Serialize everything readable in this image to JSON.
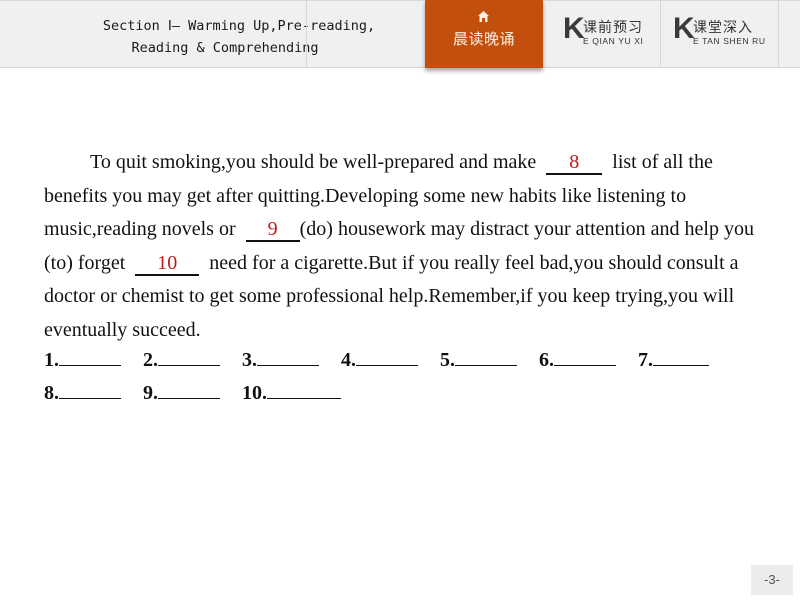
{
  "header": {
    "section_title_line1": "Section Ⅰ— Warming Up,Pre-reading,",
    "section_title_line2": "Reading & Comprehending",
    "tabs": [
      {
        "label": "晨读晚诵",
        "icon": "home-icon",
        "active": true,
        "color": "#c2500c"
      },
      {
        "k": "K",
        "label": "课前预习",
        "pinyin": "E QIAN YU XI",
        "active": false
      },
      {
        "k": "K",
        "label": "课堂深入",
        "pinyin": "E TAN SHEN RU",
        "active": false
      }
    ]
  },
  "passage": {
    "line_parts": {
      "p1": "To quit smoking,you should be well-prepared and make",
      "b8": "8",
      "p2": "list of all the benefits you may get after quitting.Developing some new habits like listening to music,reading novels or",
      "b9": "9",
      "p3": "(do) housework may distract your attention and help you (to) forget",
      "b10": "10",
      "p4": "need for a cigarette.But if you really feel bad,you should consult a doctor or chemist to get some professional help.Remember,if you keep trying,you will eventually succeed."
    },
    "answer_color": "#c0191b"
  },
  "answers": {
    "row1": [
      "1.",
      "2.",
      "3.",
      "4.",
      "5.",
      "6.",
      "7."
    ],
    "row2": [
      "8.",
      "9.",
      "10."
    ]
  },
  "page_number": "-3-"
}
